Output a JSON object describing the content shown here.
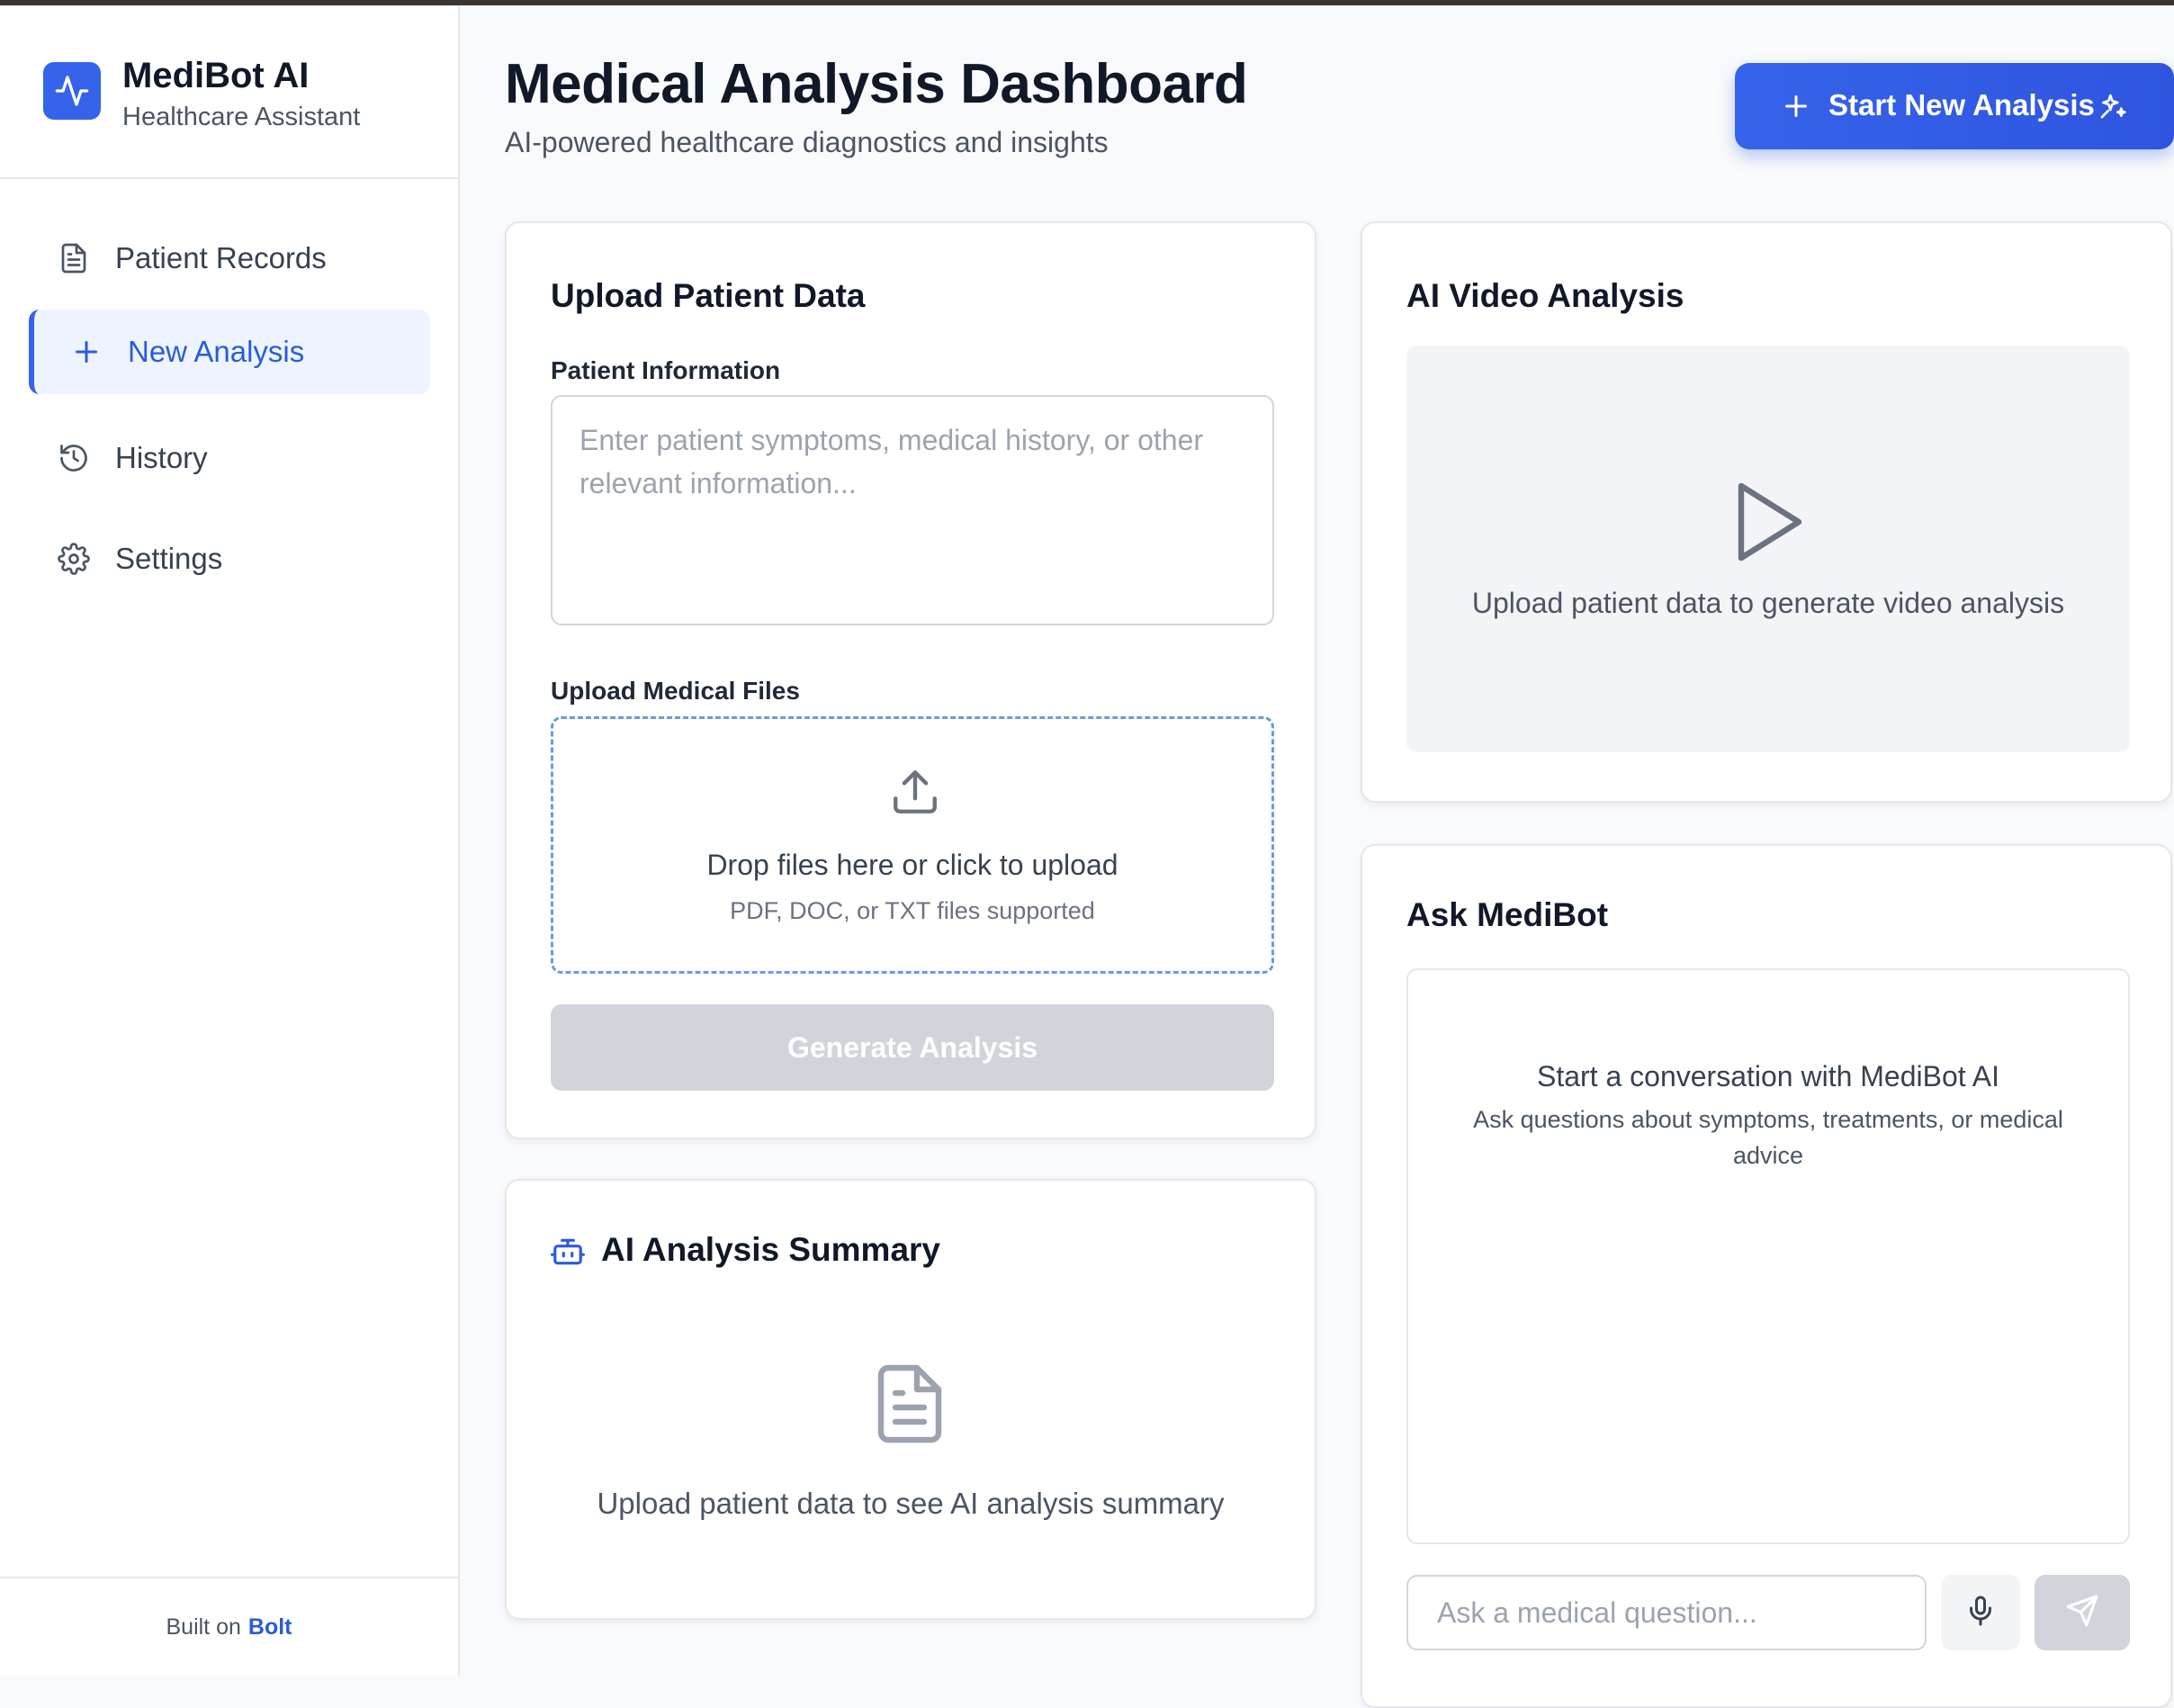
{
  "brand": {
    "title": "MediBot AI",
    "subtitle": "Healthcare Assistant",
    "logo_icon": "activity-pulse-icon",
    "accent": "#3563e9"
  },
  "sidebar": {
    "items": [
      {
        "label": "Patient Records",
        "icon": "file-text-icon",
        "active": false
      },
      {
        "label": "New Analysis",
        "icon": "plus-icon",
        "active": true
      },
      {
        "label": "History",
        "icon": "history-icon",
        "active": false
      },
      {
        "label": "Settings",
        "icon": "gear-icon",
        "active": false
      }
    ],
    "footer": {
      "prefix": "Built on",
      "link": "Bolt"
    }
  },
  "header": {
    "title": "Medical Analysis Dashboard",
    "subtitle": "AI-powered healthcare diagnostics and insights",
    "start_button": "Start New Analysis"
  },
  "upload_card": {
    "title": "Upload Patient Data",
    "patient_info_label": "Patient Information",
    "patient_info_placeholder": "Enter patient symptoms, medical history, or other relevant information...",
    "patient_info_value": "",
    "files_label": "Upload Medical Files",
    "dropzone_title": "Drop files here or click to upload",
    "dropzone_sub": "PDF, DOC, or TXT files supported",
    "generate_button": "Generate Analysis"
  },
  "summary_card": {
    "title": "AI Analysis Summary",
    "empty_text": "Upload patient data to see AI analysis summary"
  },
  "video_card": {
    "title": "AI Video Analysis",
    "empty_text": "Upload patient data to generate video analysis"
  },
  "chat_card": {
    "title": "Ask MediBot",
    "empty_title": "Start a conversation with MediBot AI",
    "empty_sub": "Ask questions about symptoms, treatments, or medical advice",
    "input_placeholder": "Ask a medical question...",
    "input_value": ""
  },
  "colors": {
    "primary": "#3563e9",
    "active_bg": "#eef4ff",
    "disabled": "#d1d5db",
    "dropzone_border": "#6b98e6"
  }
}
